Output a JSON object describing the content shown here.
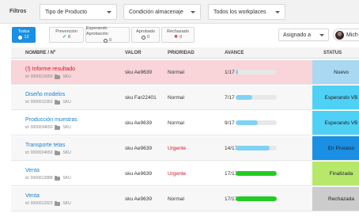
{
  "filters": {
    "label": "Filtros",
    "type_select": "Tipo de Producto",
    "condition_select": "Condición almacenaje",
    "workplace_select": "Todos los workplaces"
  },
  "status_chips": [
    {
      "label": "Todos",
      "count": "12"
    },
    {
      "label": "Prevención",
      "count": "8"
    },
    {
      "label": "Esperando Aprobación",
      "count": "0"
    },
    {
      "label": "Aprobado",
      "count": "0"
    },
    {
      "label": "Rechazado",
      "count": "0"
    }
  ],
  "assign_select": "Asignado a",
  "user_name": "Mich",
  "columns": {
    "name": "NOMBRE / Nº",
    "valor": "VALOR",
    "prioridad": "PRIORIDAD",
    "avance": "AVANCE",
    "status": "STATUS"
  },
  "rows": [
    {
      "name": "(!) Informe resultado",
      "id": "id: 0000012650",
      "tag": "SKU",
      "valor": "sku Ae9639",
      "prioridad": "Normal",
      "avance": "1/17",
      "progress": 0.06,
      "status": "Nuevo"
    },
    {
      "name": "Diseño modelos",
      "id": "id: 0000012353",
      "tag": "SKU",
      "valor": "sku Far22401",
      "prioridad": "Normal",
      "avance": "7/17",
      "progress": 0.41,
      "status": "Esperando VB"
    },
    {
      "name": "Producción muestras",
      "id": "id: 0000034650",
      "tag": "SKU",
      "valor": "sku Ae9639",
      "prioridad": "Normal",
      "avance": "9/17",
      "progress": 0.53,
      "status": "Esperando VB"
    },
    {
      "name": "Transporte telas",
      "id": "id: 0000024650",
      "tag": "SKU",
      "valor": "sku Ae9639",
      "prioridad": "Urgente",
      "avance": "14/17",
      "progress": 0.82,
      "status": "En Proceso"
    },
    {
      "name": "Venta",
      "id": "id: 0000012888",
      "tag": "SKU",
      "valor": "sku Ae9639",
      "prioridad": "Urgente",
      "avance": "17/17",
      "progress": 1.0,
      "status": "Finalizada"
    },
    {
      "name": "Venta",
      "id": "id: 0000012923",
      "tag": "SKU",
      "valor": "sku Ae9639",
      "prioridad": "Normal",
      "avance": "17/17",
      "progress": 1.0,
      "status": "Rechazada"
    }
  ],
  "colors": {
    "accent": "#1a8fe3",
    "alert_row": "#f9d4d8",
    "status_nuevo": "#a8d8f2",
    "status_esperando": "#4fd1f5",
    "status_proceso": "#1a8fe3",
    "status_finalizada": "#b7e86a",
    "status_rechazada": "#cccccc",
    "progress_blue": "#7fd2f5",
    "progress_green": "#22cc22"
  }
}
